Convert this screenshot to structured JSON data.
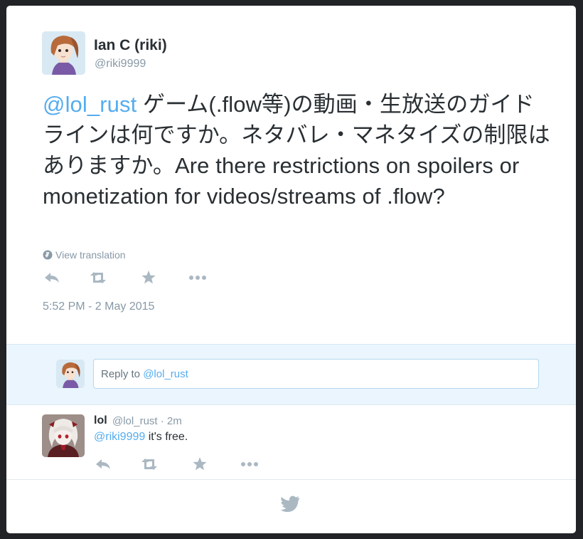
{
  "tweet": {
    "author_name": "Ian C (riki)",
    "author_handle": "@riki9999",
    "mention": "@lol_rust",
    "text": " ゲーム(.flow等)の動画・生放送のガイドラインは何ですか。ネタバレ・マネタイズの制限はありますか。Are there restrictions on spoilers or monetization for videos/streams of .flow?",
    "view_translation": "View translation",
    "timestamp": "5:52 PM - 2 May 2015",
    "actions": [
      "reply-icon",
      "retweet-icon",
      "favorite-icon",
      "more-icon"
    ]
  },
  "reply_box": {
    "prefix": "Reply to ",
    "mention": "@lol_rust"
  },
  "reply": {
    "name": "lol",
    "handle_time": "@lol_rust · 2m",
    "mention": "@riki9999",
    "text": " it's free.",
    "actions": [
      "reply-icon",
      "retweet-icon",
      "favorite-icon",
      "more-icon"
    ]
  },
  "colors": {
    "link": "#55acee",
    "muted": "#8899a6",
    "text": "#292f33",
    "reply_bg": "#eaf5fd",
    "icon": "#aab8c2"
  }
}
